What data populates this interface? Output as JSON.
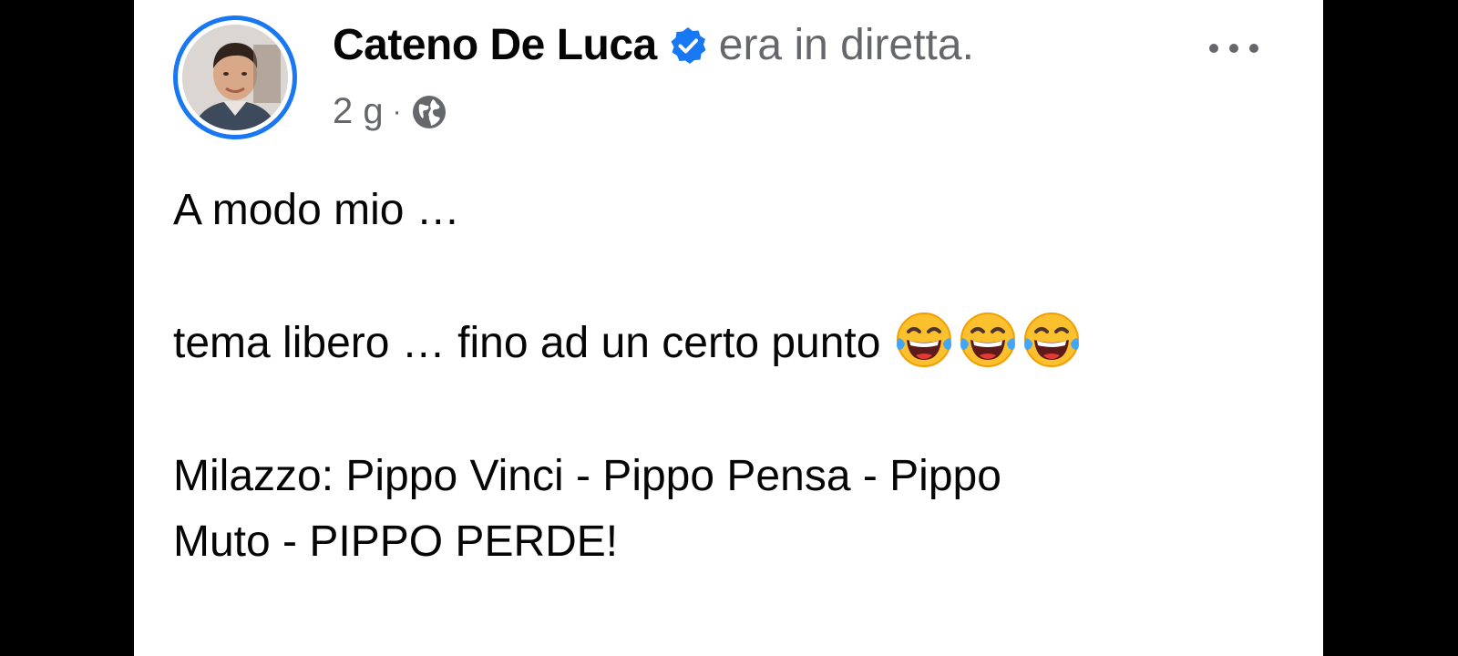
{
  "post": {
    "author": "Cateno De Luca",
    "status": "era in diretta.",
    "time": "2 g",
    "separator": "·",
    "verified_icon": "verified-badge-icon",
    "privacy_icon": "globe-icon",
    "more_icon": "more-options-icon",
    "lines": {
      "line1": "A modo mio …",
      "line2": "tema libero … fino ad un certo punto",
      "line3": "Milazzo: Pippo Vinci - Pippo Pensa - Pippo",
      "line4": "Muto - PIPPO PERDE!"
    },
    "emoji": [
      "face-with-tears-of-joy-icon",
      "face-with-tears-of-joy-icon",
      "face-with-tears-of-joy-icon"
    ]
  },
  "colors": {
    "accent": "#1877f2",
    "text": "#050505",
    "secondary_text": "#65676b",
    "background": "#ffffff",
    "frame": "#000000"
  }
}
